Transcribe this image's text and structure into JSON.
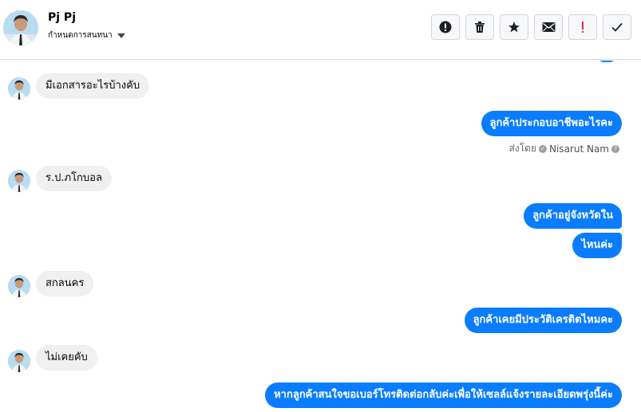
{
  "header": {
    "name": "Pj Pj",
    "subtitle": "กำหนดการสนทนา",
    "actions": [
      {
        "id": "alert",
        "icon": "exclamation-circle-icon"
      },
      {
        "id": "delete",
        "icon": "trash-icon"
      },
      {
        "id": "star",
        "icon": "star-icon"
      },
      {
        "id": "mail",
        "icon": "envelope-icon"
      },
      {
        "id": "important",
        "icon": "exclamation-icon"
      },
      {
        "id": "done",
        "icon": "checkmark-icon"
      }
    ]
  },
  "messages": {
    "m1": "มีเอกสารอะไรบ้างคับ",
    "m2": "ลูกค้าประกอบอาชีพอะไรคะ",
    "sent_by_label": "ส่งโดย",
    "sent_by_agent": "Nisarut Nam",
    "m3": "ร.ป.ภโกบอล",
    "m4a": "ลูกค้าอยู่จังหวัดใน",
    "m4b": "ไหนค่ะ",
    "m5": "สกลนคร",
    "m6": "ลูกค้าเคยมีประวัติเครดิตไหมคะ",
    "m7": "ไม่เคยคับ",
    "m8": "หากลูกค้าสนใจขอเบอร์โทรติดต่อกลับค่ะเพื่อให้เซลล์แจ้งรายละเอียดพรุ่งนี้ค่ะ"
  },
  "colors": {
    "outgoing": "#0a7cff",
    "incoming": "#f0f0f0"
  }
}
